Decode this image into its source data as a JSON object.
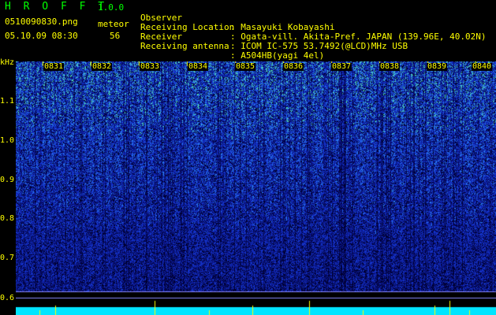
{
  "header": {
    "app_title": "H R O F F T",
    "version": "1.0.0",
    "filename": "0510090830.png",
    "mode": "meteor",
    "datetime": "05.10.09 08:30",
    "count": "56"
  },
  "station": {
    "observer_label": "Observer",
    "observer": ": Masayuki Kobayashi",
    "location_label": "Receiving Location",
    "location": ": Ogata-vill. Akita-Pref. JAPAN (139.96E, 40.02N)",
    "receiver_label": "Receiver",
    "receiver": ": ICOM IC-575 53.7492(@LCD)MHz USB",
    "antenna_label": "Receiving antenna",
    "antenna": ": A504HB(yagi 4el)"
  },
  "spectrogram": {
    "unit_label": "kHz",
    "y_ticks": [
      "1.1",
      "1.0",
      "0.9",
      "0.8",
      "0.7",
      "0.6"
    ],
    "time_labels": [
      "0831",
      "0832",
      "0833",
      "0834",
      "0835",
      "0836",
      "0837",
      "0838",
      "0839",
      "0840"
    ],
    "colors": {
      "background": "#000000",
      "text": "#ffff00",
      "title": "#00ff00",
      "baseline": "#00ffff"
    }
  }
}
